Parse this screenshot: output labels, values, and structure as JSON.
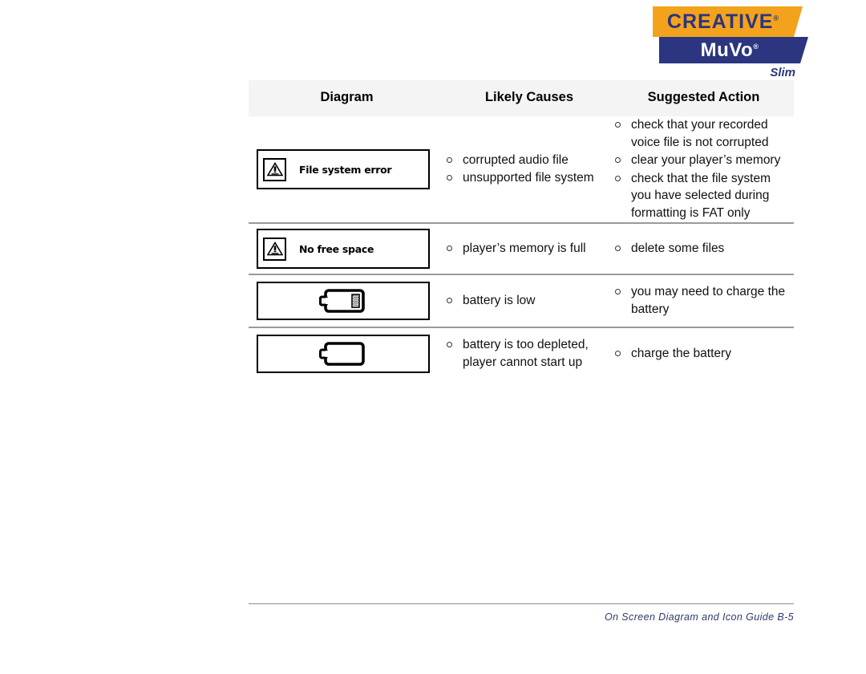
{
  "logo": {
    "brand": "CREATIVE",
    "brand_mark": "®",
    "product": "MuVo",
    "product_mark": "®",
    "variant": "Slim",
    "colors": {
      "orange": "#F3A31B",
      "navy": "#2B3580",
      "white": "#FFFFFF"
    }
  },
  "table": {
    "headers": {
      "diagram": "Diagram",
      "causes": "Likely Causes",
      "action": "Suggested Action"
    },
    "rows": [
      {
        "diagram": {
          "type": "message-screen",
          "icon": "warning-triangle-icon",
          "label": "File system error"
        },
        "causes": [
          "corrupted audio file",
          "unsupported file system"
        ],
        "actions": [
          "check that your recorded voice file is not corrupted",
          "clear your player’s memory",
          "check that the file system you have selected during formatting is FAT only"
        ]
      },
      {
        "diagram": {
          "type": "message-screen",
          "icon": "warning-triangle-icon",
          "label": "No free space"
        },
        "causes": [
          "player’s memory is full"
        ],
        "actions": [
          "delete some files"
        ]
      },
      {
        "diagram": {
          "type": "battery-screen",
          "icon": "battery-low-icon",
          "label": ""
        },
        "causes": [
          "battery is low"
        ],
        "actions": [
          "you may need to charge the battery"
        ]
      },
      {
        "diagram": {
          "type": "battery-screen",
          "icon": "battery-empty-icon",
          "label": ""
        },
        "causes": [
          "battery is too depleted, player cannot start up"
        ],
        "actions": [
          "charge the battery"
        ]
      }
    ]
  },
  "footer": {
    "text": "On Screen Diagram and Icon Guide B-5"
  }
}
